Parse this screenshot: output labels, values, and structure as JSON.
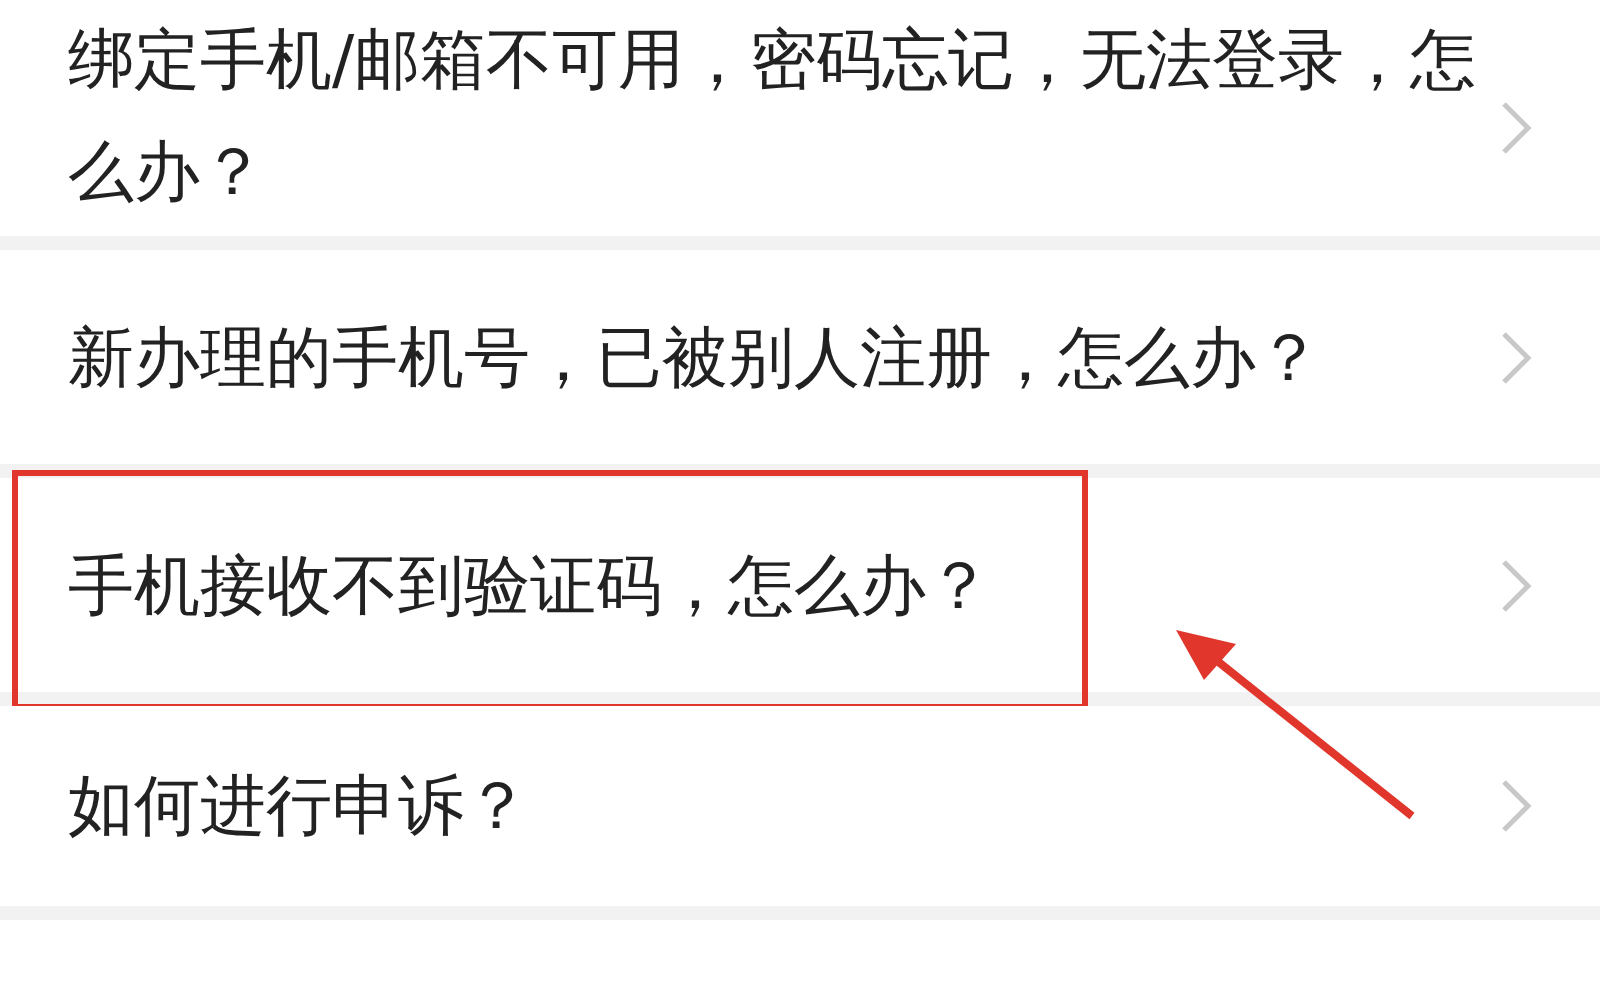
{
  "items": [
    {
      "text": "绑定手机/邮箱不可用，密码忘记，无法登录，怎么办？",
      "highlighted": false
    },
    {
      "text": "新办理的手机号，已被别人注册，怎么办？",
      "highlighted": false
    },
    {
      "text": "手机接收不到验证码，怎么办？",
      "highlighted": true
    },
    {
      "text": "如何进行申诉？",
      "highlighted": false
    }
  ]
}
